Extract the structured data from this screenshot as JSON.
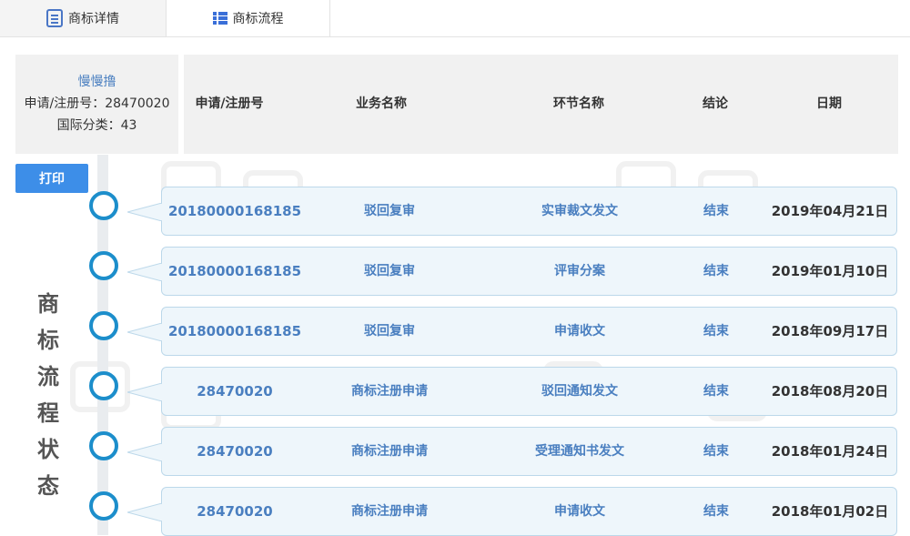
{
  "tabs": [
    {
      "label": "商标详情",
      "icon": "document-icon"
    },
    {
      "label": "商标流程",
      "icon": "list-icon"
    }
  ],
  "info": {
    "name": "慢慢撸",
    "reg_line": "申请/注册号：28470020",
    "class_line": "国际分类：43"
  },
  "table_header": {
    "reg_no": "申请/注册号",
    "business": "业务名称",
    "step": "环节名称",
    "result": "结论",
    "date": "日期"
  },
  "print_label": "打印",
  "timeline_title": [
    "商",
    "标",
    "流",
    "程",
    "状",
    "态"
  ],
  "rows": [
    {
      "reg_no": "20180000168185",
      "business": "驳回复审",
      "step": "实审裁文发文",
      "result": "结束",
      "date": "2019年04月21日"
    },
    {
      "reg_no": "20180000168185",
      "business": "驳回复审",
      "step": "评审分案",
      "result": "结束",
      "date": "2019年01月10日"
    },
    {
      "reg_no": "20180000168185",
      "business": "驳回复审",
      "step": "申请收文",
      "result": "结束",
      "date": "2018年09月17日"
    },
    {
      "reg_no": "28470020",
      "business": "商标注册申请",
      "step": "驳回通知发文",
      "result": "结束",
      "date": "2018年08月20日"
    },
    {
      "reg_no": "28470020",
      "business": "商标注册申请",
      "step": "受理通知书发文",
      "result": "结束",
      "date": "2018年01月24日"
    },
    {
      "reg_no": "28470020",
      "business": "商标注册申请",
      "step": "申请收文",
      "result": "结束",
      "date": "2018年01月02日"
    }
  ],
  "colors": {
    "accent": "#3d8ee8",
    "node": "#1c8ecb",
    "link": "#4a7fc0",
    "row_bg": "#eef6fb"
  }
}
